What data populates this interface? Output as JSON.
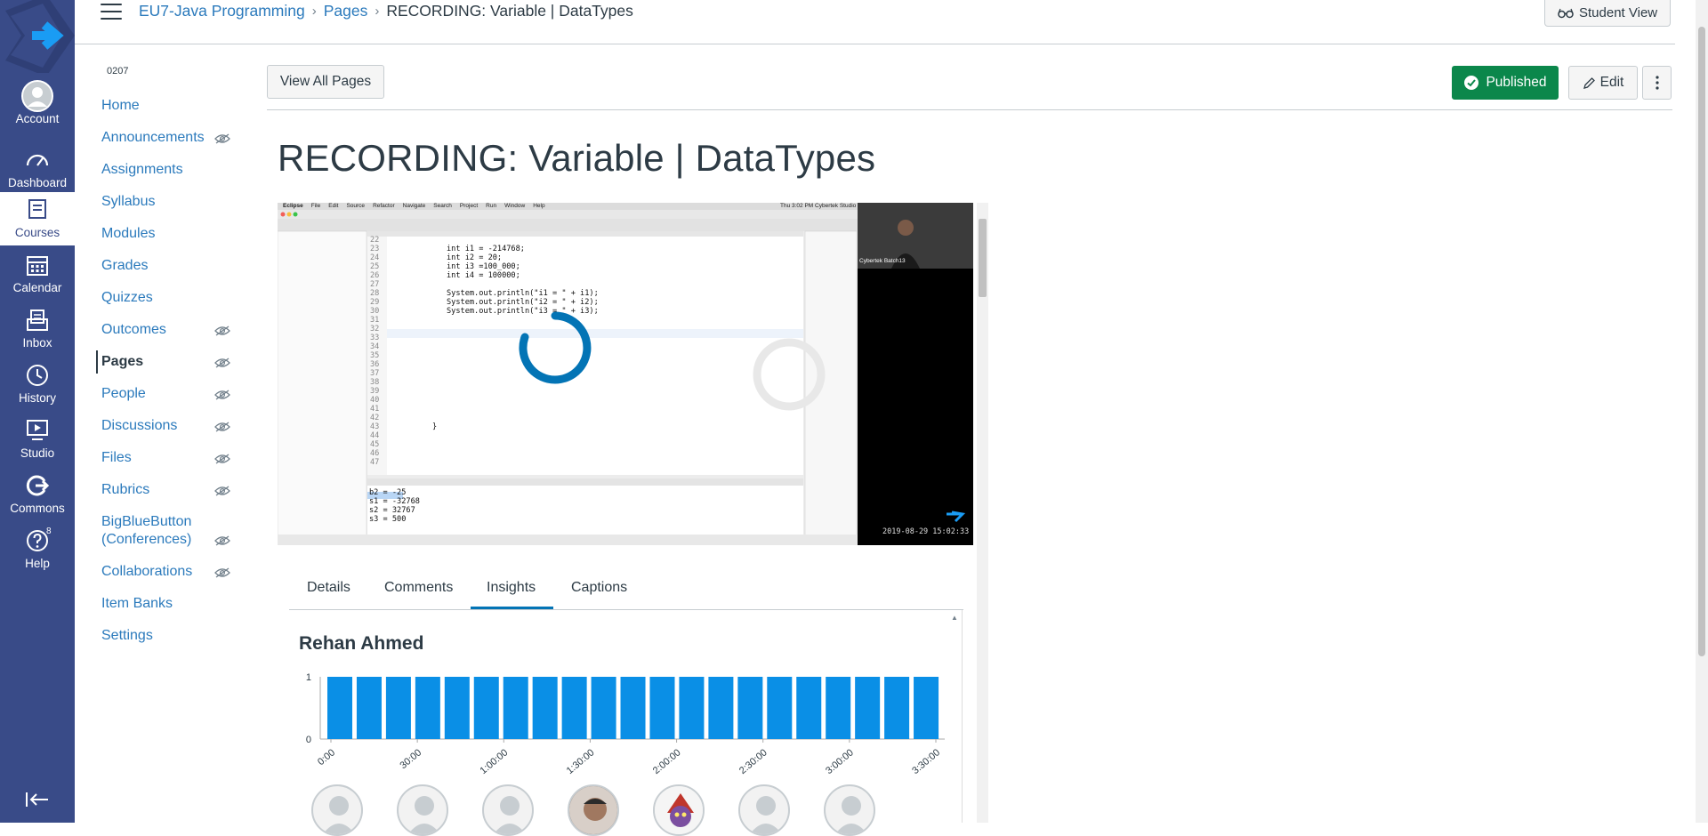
{
  "global_nav": {
    "items": [
      {
        "label": "Account",
        "icon": "account-avatar-icon"
      },
      {
        "label": "Dashboard",
        "icon": "dashboard-icon"
      },
      {
        "label": "Courses",
        "icon": "courses-icon",
        "active": true
      },
      {
        "label": "Calendar",
        "icon": "calendar-icon"
      },
      {
        "label": "Inbox",
        "icon": "inbox-icon"
      },
      {
        "label": "History",
        "icon": "history-icon"
      },
      {
        "label": "Studio",
        "icon": "studio-icon"
      },
      {
        "label": "Commons",
        "icon": "commons-icon"
      },
      {
        "label": "Help",
        "icon": "help-icon",
        "badge": "8"
      }
    ],
    "brand_color": "#394b88"
  },
  "header": {
    "breadcrumb": [
      "EU7-Java Programming",
      "Pages",
      "RECORDING: Variable | DataTypes"
    ],
    "student_view_label": "Student View"
  },
  "course_nav": {
    "course_code": "0207",
    "items": [
      {
        "label": "Home",
        "hidden": false
      },
      {
        "label": "Announcements",
        "hidden": true
      },
      {
        "label": "Assignments",
        "hidden": false
      },
      {
        "label": "Syllabus",
        "hidden": false
      },
      {
        "label": "Modules",
        "hidden": false
      },
      {
        "label": "Grades",
        "hidden": false
      },
      {
        "label": "Quizzes",
        "hidden": false
      },
      {
        "label": "Outcomes",
        "hidden": true
      },
      {
        "label": "Pages",
        "hidden": true,
        "active": true
      },
      {
        "label": "People",
        "hidden": true
      },
      {
        "label": "Discussions",
        "hidden": true
      },
      {
        "label": "Files",
        "hidden": true
      },
      {
        "label": "Rubrics",
        "hidden": true
      },
      {
        "label": "BigBlueButton",
        "label2": "(Conferences)",
        "hidden": true
      },
      {
        "label": "Collaborations",
        "hidden": true
      },
      {
        "label": "Item Banks",
        "hidden": false
      },
      {
        "label": "Settings",
        "hidden": false
      }
    ]
  },
  "toolbar": {
    "view_all_label": "View All Pages",
    "published_label": "Published",
    "edit_label": "Edit"
  },
  "page": {
    "title": "RECORDING: Variable | DataTypes"
  },
  "video": {
    "code_lines": [
      {
        "n": "22",
        "code": ""
      },
      {
        "n": "23",
        "code": "int i1 = -214768;"
      },
      {
        "n": "24",
        "code": "int i2 = 20;"
      },
      {
        "n": "25",
        "code": "int i3 =100_000;"
      },
      {
        "n": "26",
        "code": "int i4 = 100000;"
      },
      {
        "n": "27",
        "code": ""
      },
      {
        "n": "28",
        "code": "System.out.println(\"i1 = \" + i1);"
      },
      {
        "n": "29",
        "code": "System.out.println(\"i2 = \" + i2);"
      },
      {
        "n": "30",
        "code": "System.out.println(\"i3 = \" + i3);"
      },
      {
        "n": "31",
        "code": ""
      },
      {
        "n": "32",
        "code": ""
      },
      {
        "n": "33",
        "code": ""
      },
      {
        "n": "34",
        "code": ""
      },
      {
        "n": "35",
        "code": ""
      },
      {
        "n": "36",
        "code": ""
      },
      {
        "n": "37",
        "code": ""
      },
      {
        "n": "38",
        "code": ""
      },
      {
        "n": "39",
        "code": ""
      },
      {
        "n": "40",
        "code": ""
      },
      {
        "n": "41",
        "code": ""
      },
      {
        "n": "42",
        "code": ""
      },
      {
        "n": "43",
        "code": "}"
      },
      {
        "n": "44",
        "code": ""
      },
      {
        "n": "45",
        "code": ""
      },
      {
        "n": "46",
        "code": ""
      },
      {
        "n": "47",
        "code": ""
      }
    ],
    "console_lines": [
      "b2 = -25",
      "s1 = -32768",
      "s2 = 32767",
      "s3 = 500"
    ],
    "webcam_caption": "Cybertek Batch13",
    "timestamp": "2019-08-29  15:02:33",
    "menu_items": [
      "Eclipse",
      "File",
      "Edit",
      "Source",
      "Refactor",
      "Navigate",
      "Search",
      "Project",
      "Run",
      "Window",
      "Help"
    ],
    "menubar_right": "Thu 3:02 PM   Cybertek Studio"
  },
  "tabs": [
    "Details",
    "Comments",
    "Insights",
    "Captions"
  ],
  "active_tab": "Insights",
  "insights": {
    "viewer_name": "Rehan Ahmed"
  },
  "chart_data": {
    "type": "bar",
    "x": [
      "0:00",
      "30:00",
      "1:00:00",
      "1:30:00",
      "2:00:00",
      "2:30:00",
      "3:00:00",
      "3:30:00"
    ],
    "bars_count": 21,
    "values": [
      1,
      1,
      1,
      1,
      1,
      1,
      1,
      1,
      1,
      1,
      1,
      1,
      1,
      1,
      1,
      1,
      1,
      1,
      1,
      1,
      1
    ],
    "yticks": [
      "1",
      "0"
    ],
    "ylim": [
      0,
      1
    ],
    "color": "#0a8fe6"
  }
}
